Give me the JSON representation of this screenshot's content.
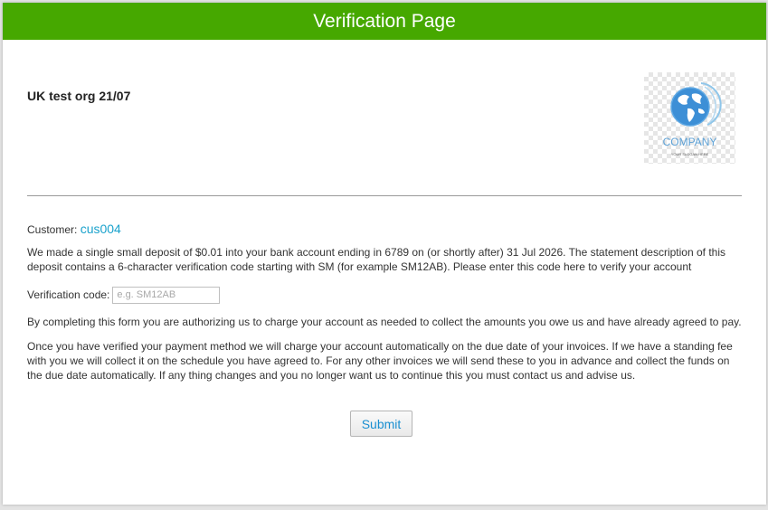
{
  "header": {
    "title": "Verification Page",
    "background_color": "#46a800"
  },
  "org": {
    "name": "UK test org 21/07"
  },
  "logo": {
    "icon": "globe-logo-icon",
    "text": "COMPANY",
    "tagline": "YOUR SLOGAN HERE"
  },
  "customer": {
    "label": "Customer:",
    "id": "cus004"
  },
  "message": {
    "deposit": "We made a single small deposit of $0.01 into your bank account ending in 6789 on (or shortly after) 31 Jul 2026. The statement description of this deposit contains a 6-character verification code starting with SM (for example SM12AB). Please enter this code here to verify your account",
    "authorization": "By completing this form you are authorizing us to charge your account as needed to collect the amounts you owe us and have already agreed to pay.",
    "schedule": "Once you have verified your payment method we will charge your account automatically on the due date of your invoices. If we have a standing fee with you we will collect it on the schedule you have agreed to. For any other invoices we will send these to you in advance and collect the funds on the due date automatically. If any thing changes and you no longer want us to continue this you must contact us and advise us."
  },
  "verification": {
    "label": "Verification code:",
    "value": "",
    "placeholder": "e.g. SM12AB"
  },
  "submit": {
    "label": "Submit",
    "text_color": "#1a8fd1"
  }
}
